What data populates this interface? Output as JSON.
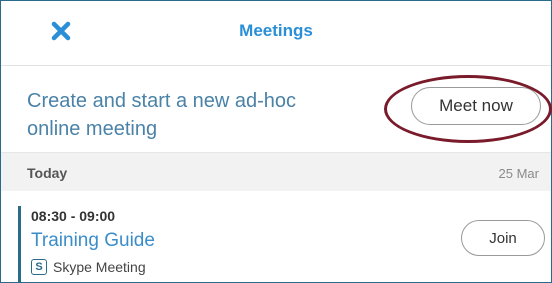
{
  "header": {
    "title": "Meetings",
    "close_icon": "close-icon",
    "accent_color": "#2a8fd6"
  },
  "adhoc": {
    "text": "Create and start a new ad-hoc online meeting",
    "button_label": "Meet now"
  },
  "day": {
    "label": "Today",
    "date": "25 Mar"
  },
  "meetings": [
    {
      "time": "08:30 - 09:00",
      "title": "Training Guide",
      "type": "Skype Meeting",
      "type_icon": "skype-icon",
      "join_label": "Join"
    }
  ],
  "colors": {
    "title_blue": "#2a8fd6",
    "highlight_ring": "#7a1b2b",
    "accent_bar": "#2a6a8a"
  }
}
